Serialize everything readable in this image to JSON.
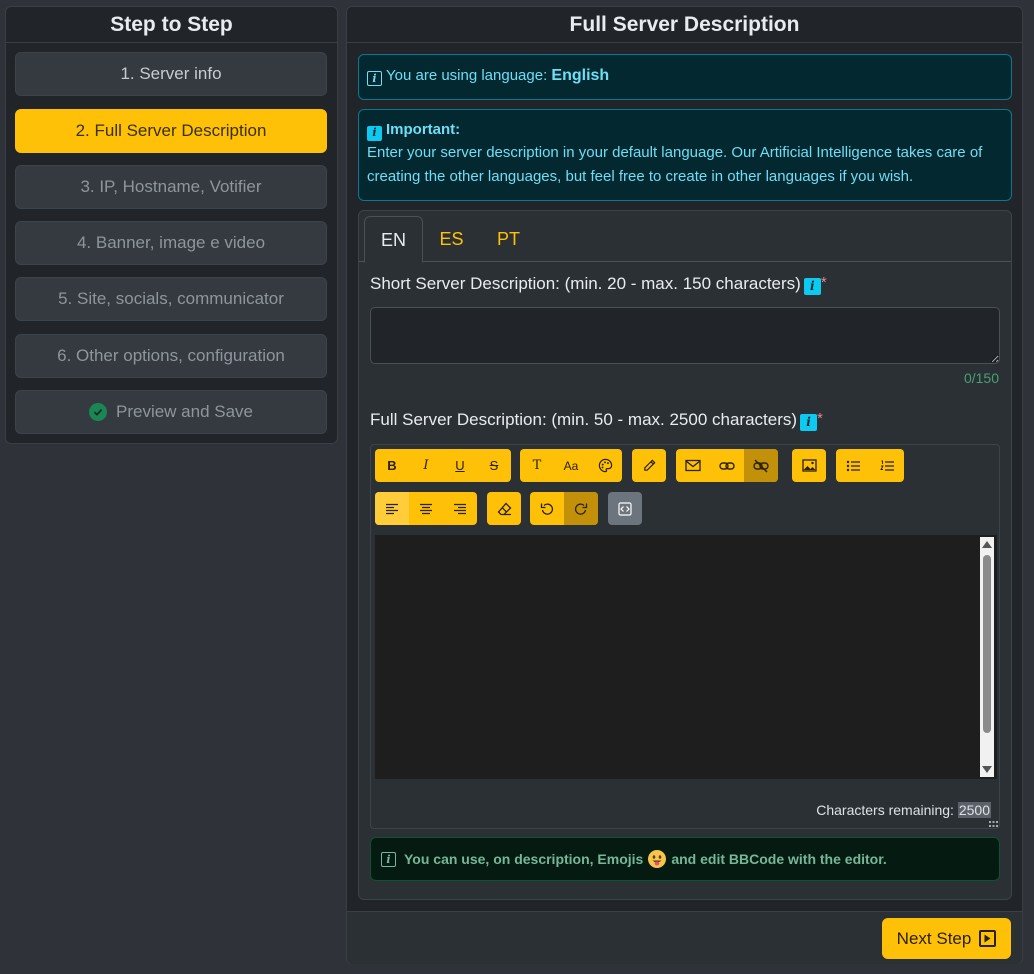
{
  "sidebar": {
    "title": "Step to Step",
    "steps": [
      {
        "label": "1. Server info"
      },
      {
        "label": "2. Full Server Description"
      },
      {
        "label": "3. IP, Hostname, Votifier"
      },
      {
        "label": "4. Banner, image e video"
      },
      {
        "label": "5. Site, socials, communicator"
      },
      {
        "label": "6. Other options, configuration"
      },
      {
        "label": "Preview and Save",
        "icon": "check-circle-icon"
      }
    ]
  },
  "main": {
    "title": "Full Server Description",
    "language_alert": {
      "prefix": "You are using language:",
      "language": "English"
    },
    "important_alert": {
      "title": "Important:",
      "text": "Enter your server description in your default language. Our Artificial Intelligence takes care of creating the other languages, but feel free to create in other languages if you wish."
    },
    "tabs": [
      "EN",
      "ES",
      "PT"
    ],
    "short_desc": {
      "label": "Short Server Description: (min. 20 - max. 150 characters)",
      "value": "",
      "counter": "0/150"
    },
    "full_desc": {
      "label": "Full Server Description: (min. 50 - max. 2500 characters)",
      "chars_label": "Characters remaining:",
      "chars_value": "2500"
    },
    "toolbar": {
      "bold": "B",
      "italic": "I",
      "underline": "U",
      "strike": "S",
      "font": "T",
      "size": "Aa"
    },
    "tip": {
      "before_emoji": "You can use, on description, Emojis",
      "after_emoji": "and edit BBCode with the editor."
    },
    "next_button": "Next Step"
  },
  "colors": {
    "accent": "#ffc107",
    "info": "#6edff6",
    "success": "#75b798"
  }
}
